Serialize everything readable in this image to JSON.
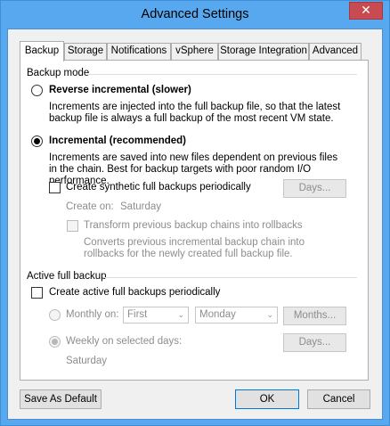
{
  "window": {
    "title": "Advanced Settings",
    "close_glyph": "✕"
  },
  "tabs": [
    {
      "label": "Backup",
      "active": true
    },
    {
      "label": "Storage",
      "active": false
    },
    {
      "label": "Notifications",
      "active": false
    },
    {
      "label": "vSphere",
      "active": false
    },
    {
      "label": "Storage Integration",
      "active": false
    },
    {
      "label": "Advanced",
      "active": false
    }
  ],
  "backup_mode": {
    "group_label": "Backup mode",
    "reverse": {
      "label": "Reverse incremental (slower)",
      "description": "Increments are injected into the full backup file, so that the latest backup file is always a full backup of the most recent VM state.",
      "selected": false
    },
    "incremental": {
      "label": "Incremental (recommended)",
      "description": "Increments are saved into new files dependent on previous files in the chain. Best for backup targets with poor random I/O performance.",
      "selected": true
    },
    "synthetic": {
      "label": "Create synthetic full backups periodically",
      "checked": false,
      "days_button": "Days...",
      "create_on_label": "Create on:",
      "create_on_value": "Saturday"
    },
    "transform": {
      "label": "Transform previous backup chains into rollbacks",
      "checked": false,
      "description": "Converts previous incremental backup chain into rollbacks for the newly created full backup file."
    }
  },
  "active_full": {
    "group_label": "Active full backup",
    "create": {
      "label": "Create active full backups periodically",
      "checked": false
    },
    "monthly": {
      "label": "Monthly on:",
      "week_select": "First",
      "day_select": "Monday",
      "months_button": "Months...",
      "selected": false
    },
    "weekly": {
      "label": "Weekly on selected days:",
      "days_button": "Days...",
      "days_value": "Saturday",
      "selected": true
    }
  },
  "footer": {
    "save_default": "Save As Default",
    "ok": "OK",
    "cancel": "Cancel"
  },
  "icons": {
    "dropdown": "⌄"
  }
}
